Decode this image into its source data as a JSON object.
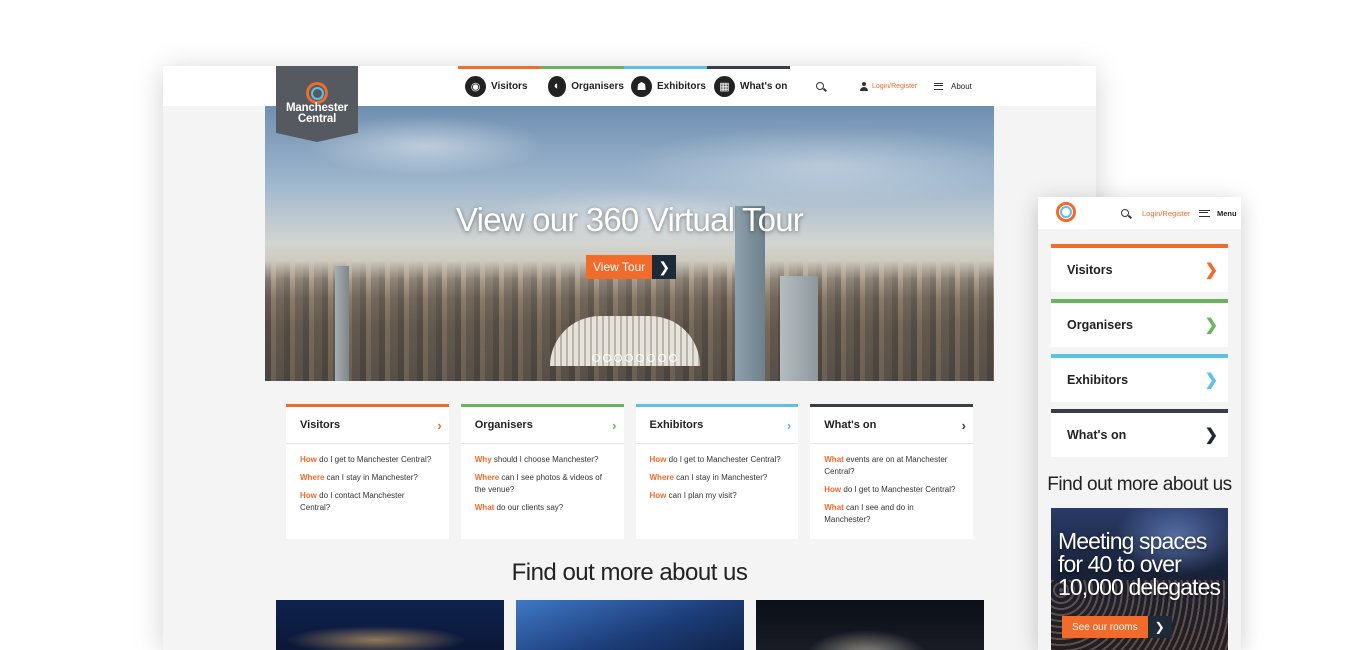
{
  "colors": {
    "orange": "#f26b2b",
    "green": "#6bb45e",
    "blue": "#5bc1e8",
    "dark": "#3a3d45",
    "nav_dark": "#1f2a38"
  },
  "desktop": {
    "logo": {
      "line1": "Manchester",
      "line2": "Central"
    },
    "nav": [
      {
        "label": "Visitors",
        "icon": "eye-icon",
        "color": "#f26b2b"
      },
      {
        "label": "Organisers",
        "icon": "compass-icon",
        "color": "#6bb45e"
      },
      {
        "label": "Exhibitors",
        "icon": "people-icon",
        "color": "#5bc1e8"
      },
      {
        "label": "What's on",
        "icon": "calendar-icon",
        "color": "#3a3d45"
      }
    ],
    "utility": {
      "login": "Login/Register",
      "about": "About"
    },
    "hero": {
      "title": "View our 360 Virtual Tour",
      "cta": "View Tour",
      "slide_count": 8
    },
    "cards": [
      {
        "title": "Visitors",
        "color": "#f26b2b",
        "questions": [
          {
            "kw": "How",
            "text": " do I get to Manchester Central?"
          },
          {
            "kw": "Where",
            "text": " can I stay in Manchester?"
          },
          {
            "kw": "How",
            "text": " do I contact Manchester Central?"
          }
        ]
      },
      {
        "title": "Organisers",
        "color": "#6bb45e",
        "questions": [
          {
            "kw": "Why",
            "text": " should I choose Manchester?"
          },
          {
            "kw": "Where",
            "text": " can I see photos & videos of the venue?"
          },
          {
            "kw": "What",
            "text": " do our clients say?"
          }
        ]
      },
      {
        "title": "Exhibitors",
        "color": "#5bc1e8",
        "questions": [
          {
            "kw": "How",
            "text": " do I get to Manchester Central?"
          },
          {
            "kw": "Where",
            "text": " can I stay in Manchester?"
          },
          {
            "kw": "How",
            "text": " can I plan my visit?"
          }
        ]
      },
      {
        "title": "What's on",
        "color": "#3a3d45",
        "questions": [
          {
            "kw": "What",
            "text": " events are on at Manchester Central?"
          },
          {
            "kw": "How",
            "text": " do I get to Manchester Central?"
          },
          {
            "kw": "What",
            "text": " can I see and do in Manchester?"
          }
        ]
      }
    ],
    "find_more": "Find out more about us"
  },
  "mobile": {
    "login": "Login/Register",
    "menu": "Menu",
    "tiles": [
      {
        "label": "Visitors",
        "color": "#f26b2b"
      },
      {
        "label": "Organisers",
        "color": "#6bb45e"
      },
      {
        "label": "Exhibitors",
        "color": "#5bc1e8"
      },
      {
        "label": "What's on",
        "color": "#3a3d45"
      }
    ],
    "find_more": "Find out more about us",
    "promo": {
      "line1": "Meeting spaces",
      "line2": "for 40 to over",
      "line3": "10,000 delegates",
      "cta": "See our rooms"
    }
  }
}
